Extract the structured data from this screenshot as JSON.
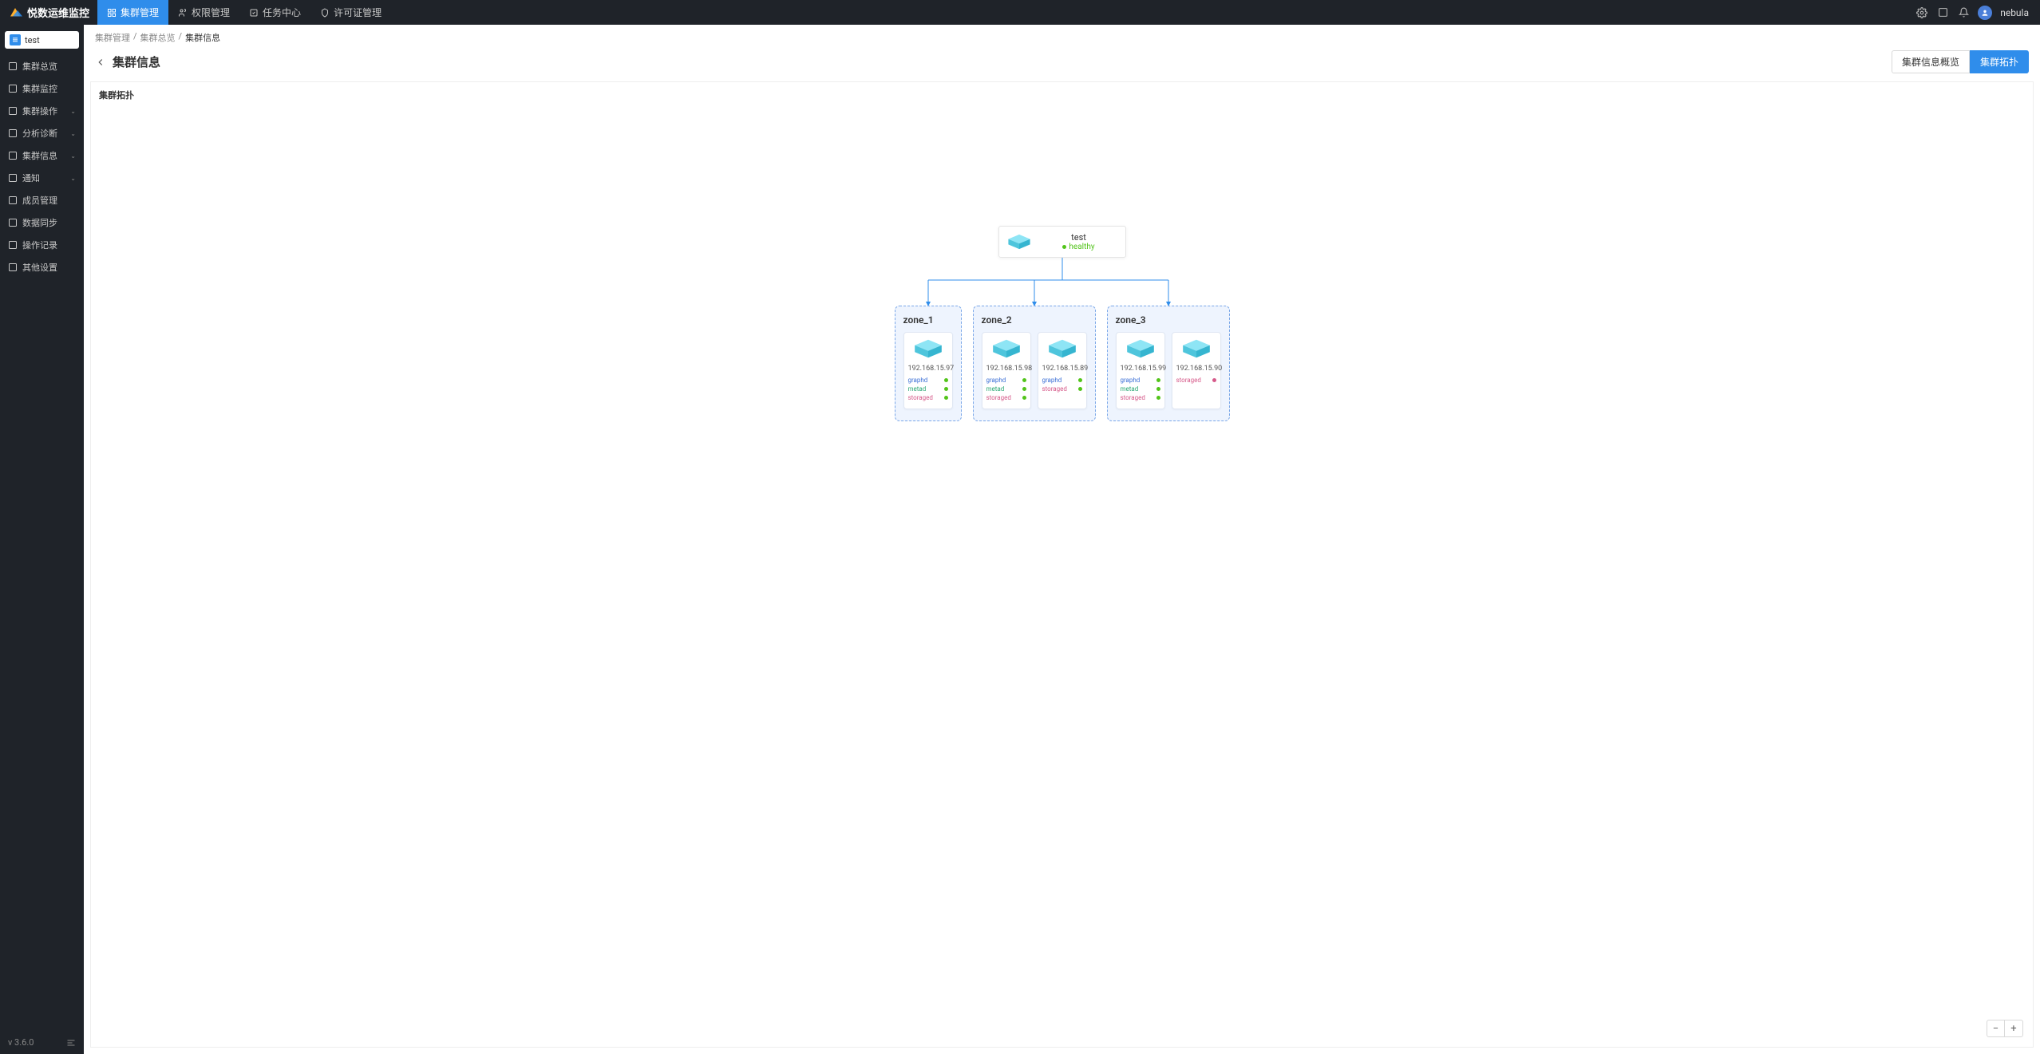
{
  "brand": {
    "name": "悦数运维监控"
  },
  "nav": {
    "tabs": [
      {
        "label": "集群管理",
        "active": true
      },
      {
        "label": "权限管理",
        "active": false
      },
      {
        "label": "任务中心",
        "active": false
      },
      {
        "label": "许可证管理",
        "active": false
      }
    ],
    "user": "nebula"
  },
  "sidebar": {
    "cluster": "test",
    "items": [
      {
        "label": "集群总览",
        "icon": "dashboard",
        "expandable": false
      },
      {
        "label": "集群监控",
        "icon": "monitor",
        "expandable": false
      },
      {
        "label": "集群操作",
        "icon": "ops",
        "expandable": true
      },
      {
        "label": "分析诊断",
        "icon": "diag",
        "expandable": true
      },
      {
        "label": "集群信息",
        "icon": "info",
        "expandable": true
      },
      {
        "label": "通知",
        "icon": "bell",
        "expandable": true
      },
      {
        "label": "成员管理",
        "icon": "users",
        "expandable": false
      },
      {
        "label": "数据同步",
        "icon": "sync",
        "expandable": false
      },
      {
        "label": "操作记录",
        "icon": "log",
        "expandable": false
      },
      {
        "label": "其他设置",
        "icon": "settings",
        "expandable": false
      }
    ],
    "version": "v 3.6.0"
  },
  "breadcrumb": {
    "items": [
      "集群管理",
      "集群总览",
      "集群信息"
    ]
  },
  "page": {
    "title": "集群信息",
    "tabs": [
      {
        "label": "集群信息概览",
        "active": false
      },
      {
        "label": "集群拓扑",
        "active": true
      }
    ],
    "section_label": "集群拓扑"
  },
  "topology": {
    "root": {
      "name": "test",
      "status": "healthy"
    },
    "zones": [
      {
        "name": "zone_1",
        "hosts": [
          {
            "ip": "192.168.15.97",
            "services": [
              {
                "name": "graphd",
                "type": "graphd",
                "ok": true
              },
              {
                "name": "metad",
                "type": "metad",
                "ok": true
              },
              {
                "name": "storaged",
                "type": "storaged",
                "ok": true
              }
            ]
          }
        ]
      },
      {
        "name": "zone_2",
        "hosts": [
          {
            "ip": "192.168.15.98",
            "services": [
              {
                "name": "graphd",
                "type": "graphd",
                "ok": true
              },
              {
                "name": "metad",
                "type": "metad",
                "ok": true
              },
              {
                "name": "storaged",
                "type": "storaged",
                "ok": true
              }
            ]
          },
          {
            "ip": "192.168.15.89",
            "services": [
              {
                "name": "graphd",
                "type": "graphd",
                "ok": true
              },
              {
                "name": "storaged",
                "type": "storaged",
                "ok": true
              }
            ]
          }
        ]
      },
      {
        "name": "zone_3",
        "hosts": [
          {
            "ip": "192.168.15.99",
            "services": [
              {
                "name": "graphd",
                "type": "graphd",
                "ok": true
              },
              {
                "name": "metad",
                "type": "metad",
                "ok": true
              },
              {
                "name": "storaged",
                "type": "storaged",
                "ok": true
              }
            ]
          },
          {
            "ip": "192.168.15.90",
            "services": [
              {
                "name": "storaged",
                "type": "storaged",
                "ok": false
              }
            ]
          }
        ]
      }
    ]
  }
}
